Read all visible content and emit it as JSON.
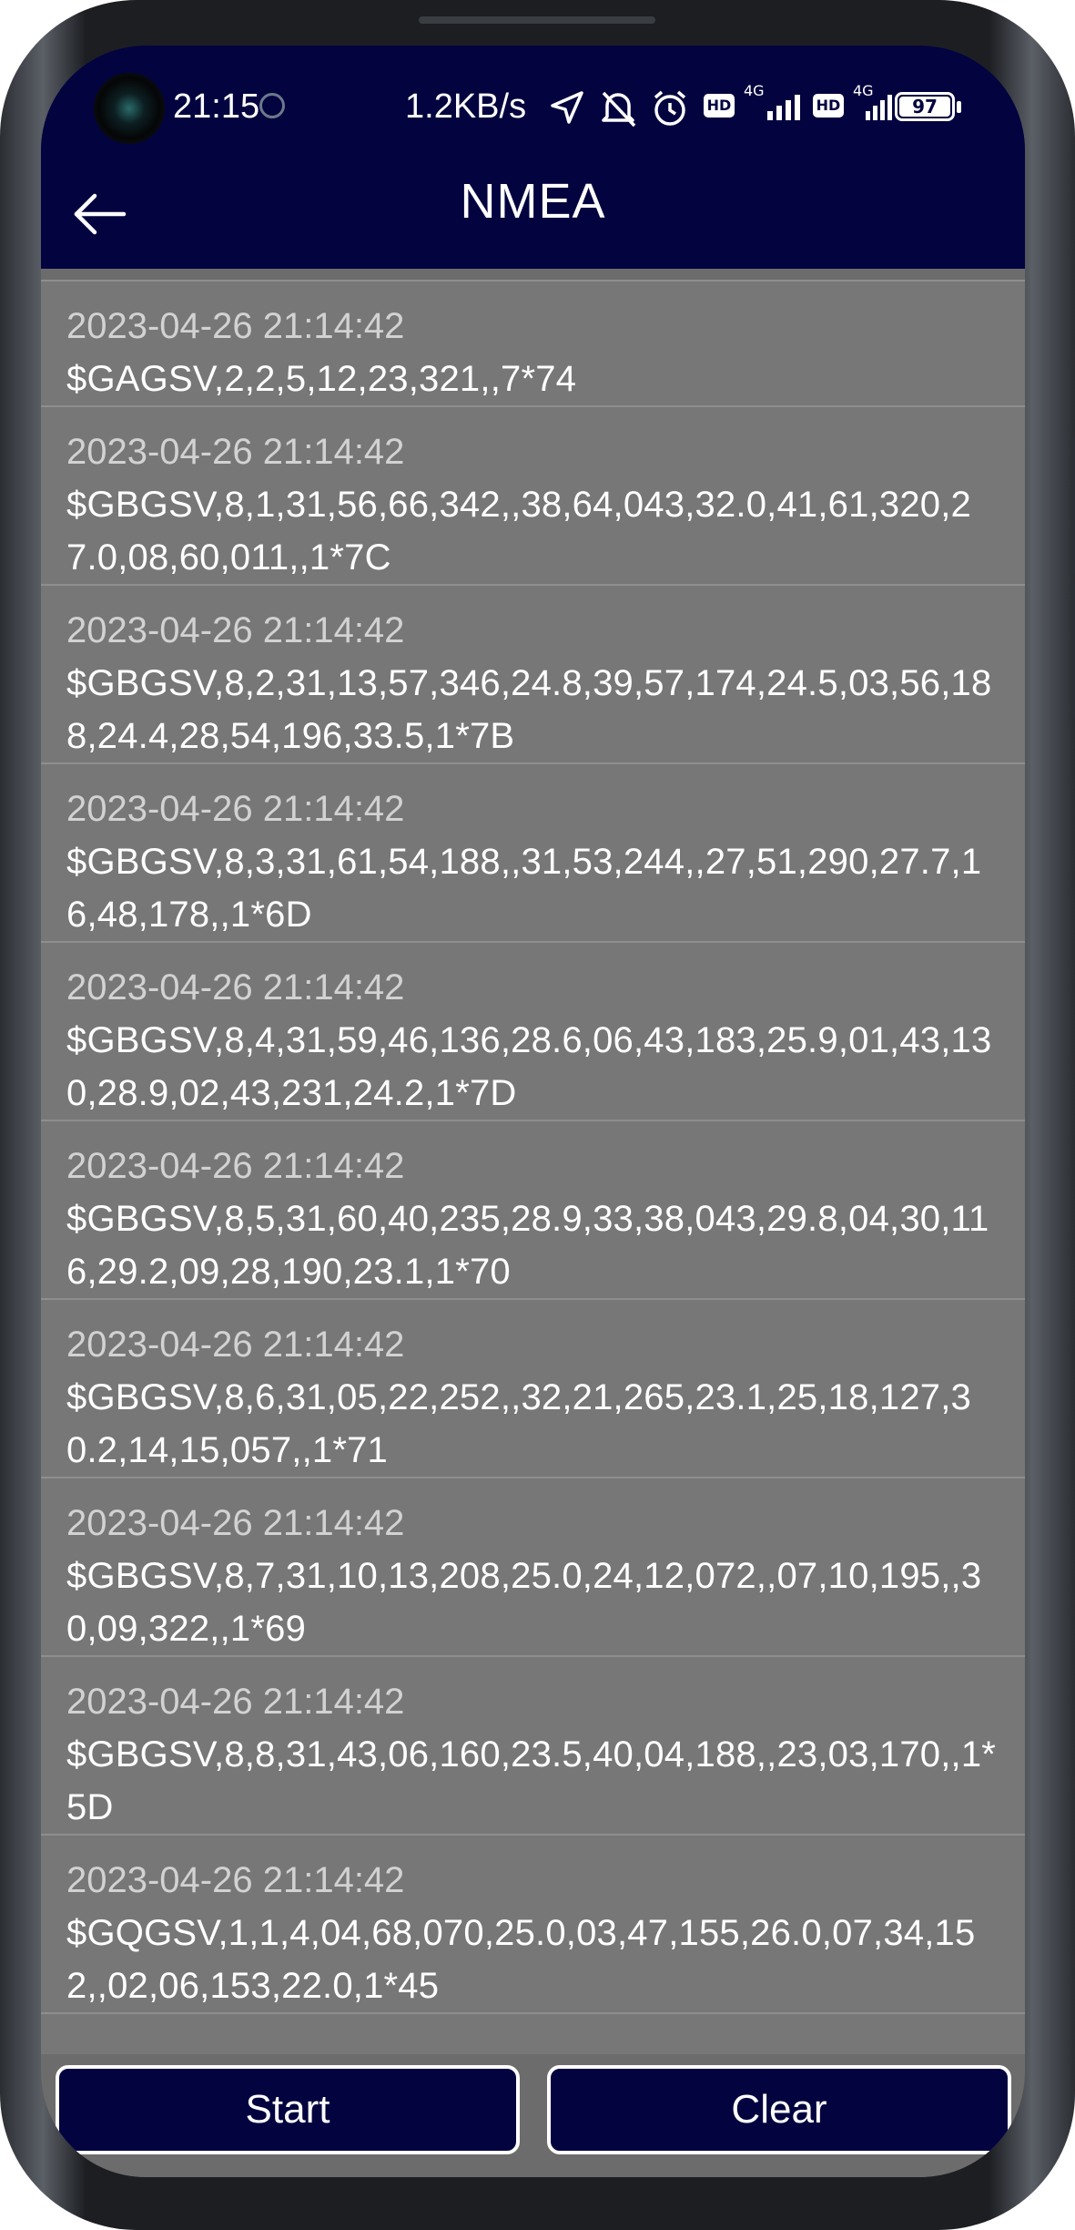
{
  "status_bar": {
    "time": "21:15",
    "net_speed": "1.2KB/s",
    "icons": [
      "location-arrow-icon",
      "mute-icon",
      "alarm-icon",
      "hd-icon",
      "signal-4g-icon",
      "hd-icon",
      "signal-4g-icon"
    ],
    "hd_label": "HD",
    "network_label": "4G",
    "battery": "97"
  },
  "header": {
    "title": "NMEA",
    "back_icon": "arrow-left-icon"
  },
  "colors": {
    "appbar": "#03033f",
    "list_bg": "#777777",
    "divider": "#8e8e8e",
    "timestamp": "#d2d2d2",
    "message": "#ffffff"
  },
  "log": [
    {
      "time": "2023-04-26 21:14:42",
      "message": "$GAGSV,2,2,5,12,23,321,,7*74"
    },
    {
      "time": "2023-04-26 21:14:42",
      "message": "$GBGSV,8,1,31,56,66,342,,38,64,043,32.0,41,61,320,27.0,08,60,011,,1*7C"
    },
    {
      "time": "2023-04-26 21:14:42",
      "message": "$GBGSV,8,2,31,13,57,346,24.8,39,57,174,24.5,03,56,188,24.4,28,54,196,33.5,1*7B"
    },
    {
      "time": "2023-04-26 21:14:42",
      "message": "$GBGSV,8,3,31,61,54,188,,31,53,244,,27,51,290,27.7,16,48,178,,1*6D"
    },
    {
      "time": "2023-04-26 21:14:42",
      "message": "$GBGSV,8,4,31,59,46,136,28.6,06,43,183,25.9,01,43,130,28.9,02,43,231,24.2,1*7D"
    },
    {
      "time": "2023-04-26 21:14:42",
      "message": "$GBGSV,8,5,31,60,40,235,28.9,33,38,043,29.8,04,30,116,29.2,09,28,190,23.1,1*70"
    },
    {
      "time": "2023-04-26 21:14:42",
      "message": "$GBGSV,8,6,31,05,22,252,,32,21,265,23.1,25,18,127,30.2,14,15,057,,1*71"
    },
    {
      "time": "2023-04-26 21:14:42",
      "message": "$GBGSV,8,7,31,10,13,208,25.0,24,12,072,,07,10,195,,30,09,322,,1*69"
    },
    {
      "time": "2023-04-26 21:14:42",
      "message": "$GBGSV,8,8,31,43,06,160,23.5,40,04,188,,23,03,170,,1*5D"
    },
    {
      "time": "2023-04-26 21:14:42",
      "message": "$GQGSV,1,1,4,04,68,070,25.0,03,47,155,26.0,07,34,152,,02,06,153,22.0,1*45"
    }
  ],
  "actions": {
    "start_label": "Start",
    "clear_label": "Clear"
  }
}
